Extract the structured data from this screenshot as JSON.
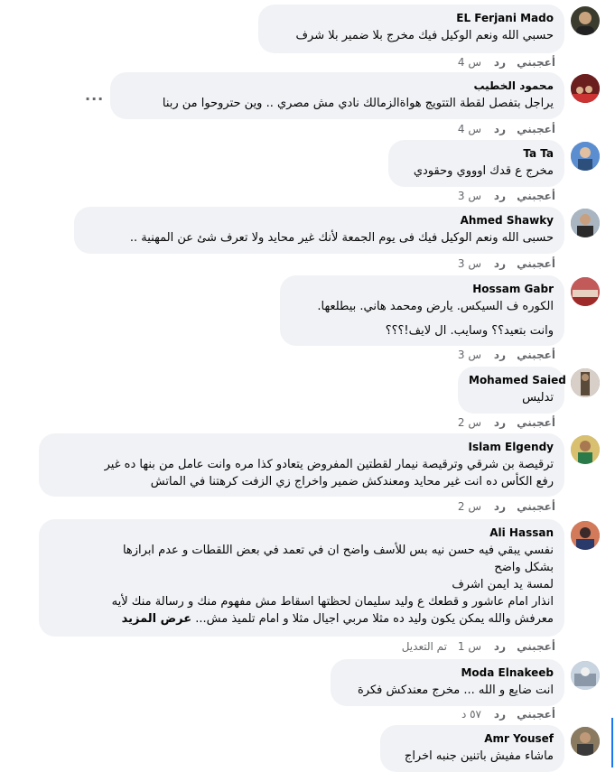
{
  "comments": [
    {
      "author": "EL Ferjani Mado",
      "lines": [
        "حسبي الله ونعم الوكيل فيك مخرج بلا ضمير بلا شرف"
      ],
      "like": "أعجبني",
      "reply": "رد",
      "time": "4 س",
      "edited": "",
      "avatar_color": "#3b3b2e"
    },
    {
      "author": "محمود الخطيب",
      "lines": [
        "يراجل بتفصل لقطة التتويج هواةالزمالك نادي مش مصري .. وين حتروحوا من ربنا"
      ],
      "like": "أعجبني",
      "reply": "رد",
      "time": "4 س",
      "edited": "",
      "avatar_color": "#8a2a2a",
      "more_icon": "..."
    },
    {
      "author": "Ta Ta",
      "lines": [
        "مخرج ع قدك اوووي وحقودي"
      ],
      "like": "أعجبني",
      "reply": "رد",
      "time": "3 س",
      "edited": "",
      "avatar_color": "#4a7fc1"
    },
    {
      "author": "Ahmed Shawky",
      "lines": [
        "حسبى الله ونعم الوكيل فيك فى يوم الجمعة لأنك غير محايد ولا تعرف شئ عن المهنية .."
      ],
      "like": "أعجبني",
      "reply": "رد",
      "time": "3 س",
      "edited": "",
      "avatar_color": "#6b7f8f"
    },
    {
      "author": "Hossam Gabr",
      "lines": [
        "الكوره ف السيكس. يارض ومحمد هاني. بيطلعها.",
        "وانت بتعيد؟؟ وسايب. ال لايف!؟؟؟"
      ],
      "like": "أعجبني",
      "reply": "رد",
      "time": "3 س",
      "edited": "",
      "avatar_color": "#b84a4a"
    },
    {
      "author": "Mohamed Saied",
      "lines": [
        "تدليس"
      ],
      "like": "أعجبني",
      "reply": "رد",
      "time": "2 س",
      "edited": "",
      "avatar_color": "#7a6a5a"
    },
    {
      "author": "Islam Elgendy",
      "lines": [
        "ترقيصة بن شرقي وترقيصة نيمار لقطتين المفروض يتعادو كذا مره وانت عامل من بنها ده غير",
        "رفع الكأس ده انت غير محايد ومعندكش ضمير واخراج زي الزفت كرهتنا في الماتش"
      ],
      "like": "أعجبني",
      "reply": "رد",
      "time": "2 س",
      "edited": "",
      "avatar_color": "#c9a64a"
    },
    {
      "author": "Ali Hassan",
      "lines": [
        "نفسي يبقي فيه حسن نيه بس للأسف واضح ان في تعمد في بعض اللقطات و عدم ابرازها",
        "بشكل واضح",
        "لمسة يد ايمن اشرف",
        "انذار امام عاشور و قطعك ع وليد سليمان لحظتها اسقاط مش مفهوم منك و رسالة منك لأيه",
        "معرفش والله يمكن يكون وليد ده مثلا مربي اجيال مثلا و امام تلميذ مش..."
      ],
      "see_more": "عرض المزيد",
      "like": "أعجبني",
      "reply": "رد",
      "time": "1 س",
      "edited": "تم التعديل",
      "avatar_color": "#c2553a"
    },
    {
      "author": "Moda Elnakeeb",
      "lines": [
        "انت ضايع و الله ... مخرج معندكش فكرة"
      ],
      "like": "أعجبني",
      "reply": "رد",
      "time": "٥٧ د",
      "edited": "",
      "avatar_color": "#9aa8b8"
    },
    {
      "author": "Amr Yousef",
      "lines": [
        "ماشاء مفيش باتنين جنبه اخراج"
      ],
      "like": "",
      "reply": "",
      "time": "",
      "edited": "",
      "avatar_color": "#6a5a45"
    }
  ]
}
